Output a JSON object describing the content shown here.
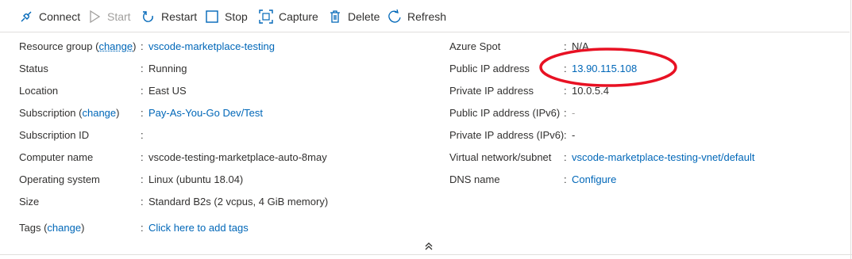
{
  "toolbar": {
    "connect": "Connect",
    "start": "Start",
    "restart": "Restart",
    "stop": "Stop",
    "capture": "Capture",
    "delete": "Delete",
    "refresh": "Refresh"
  },
  "left": {
    "resource_group": {
      "key_pre": "Resource group (",
      "change": "change",
      "key_post": ")",
      "value": "vscode-marketplace-testing"
    },
    "status": {
      "key": "Status",
      "value": "Running"
    },
    "location": {
      "key": "Location",
      "value": "East US"
    },
    "subscription": {
      "key_pre": "Subscription (",
      "change": "change",
      "key_post": ")",
      "value": "Pay-As-You-Go Dev/Test"
    },
    "subscription_id": {
      "key": "Subscription ID",
      "value": ""
    },
    "computer_name": {
      "key": "Computer name",
      "value": "vscode-testing-marketplace-auto-8may"
    },
    "os": {
      "key": "Operating system",
      "value": "Linux (ubuntu 18.04)"
    },
    "size": {
      "key": "Size",
      "value": "Standard B2s (2 vcpus, 4 GiB memory)"
    },
    "tags": {
      "key_pre": "Tags (",
      "change": "change",
      "key_post": ")",
      "value": "Click here to add tags"
    }
  },
  "right": {
    "azure_spot": {
      "key": "Azure Spot",
      "value": "N/A"
    },
    "public_ip": {
      "key": "Public IP address",
      "value": "13.90.115.108"
    },
    "private_ip": {
      "key": "Private IP address",
      "value": "10.0.5.4"
    },
    "public_ipv6": {
      "key": "Public IP address (IPv6)",
      "value": "-"
    },
    "private_ipv6": {
      "key": "Private IP address (IPv6)",
      "value": "-"
    },
    "vnet": {
      "key": "Virtual network/subnet",
      "value": "vscode-marketplace-testing-vnet/default"
    },
    "dns": {
      "key": "DNS name",
      "value": "Configure"
    }
  },
  "separator": ":",
  "colors": {
    "link": "#0067b8",
    "annotation": "#e81123",
    "text": "#323130",
    "disabled": "#a19f9d"
  }
}
